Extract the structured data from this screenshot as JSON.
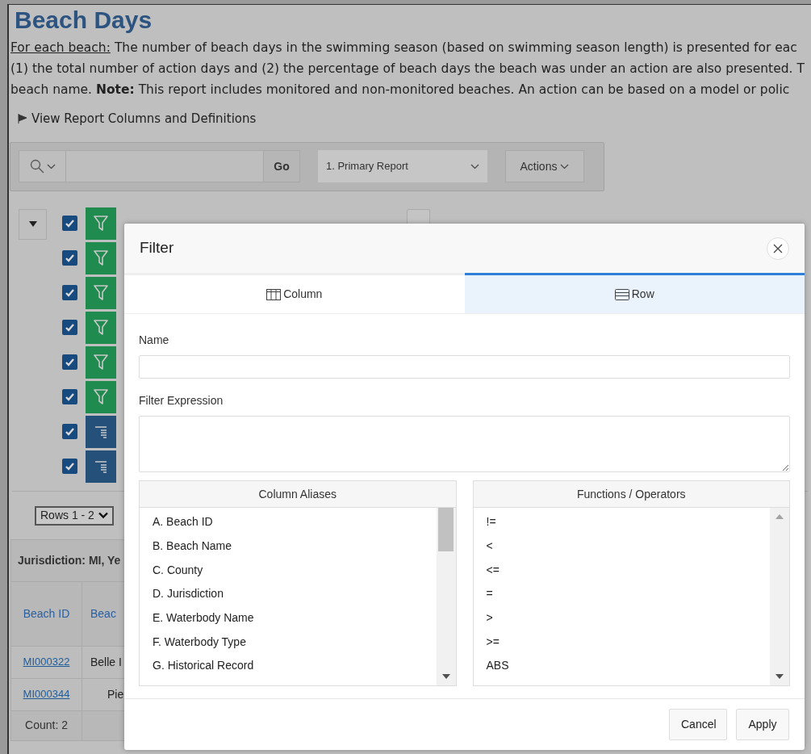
{
  "page_title": "Beach Days",
  "description": {
    "lead": "For each beach:",
    "lines": [
      "The number of beach days in the swimming season (based on swimming season length) is presented for eac",
      "(1) the total number of action days and (2) the percentage of beach days the beach was under an action are also presented. T",
      "beach name. **Note:** This report includes monitored and non-monitored beaches. An action can be based on a model or polic"
    ]
  },
  "definitions_link": "View Report Columns and Definitions",
  "toolbar": {
    "go_button": "Go",
    "report_select": "1. Primary Report",
    "actions_button": "Actions"
  },
  "report_settings": [
    {
      "kind": "filter",
      "checked": true
    },
    {
      "kind": "filter",
      "checked": true
    },
    {
      "kind": "filter",
      "checked": true
    },
    {
      "kind": "filter",
      "checked": true
    },
    {
      "kind": "filter",
      "checked": true
    },
    {
      "kind": "filter",
      "checked": true
    },
    {
      "kind": "lines",
      "checked": true
    },
    {
      "kind": "lines",
      "checked": true
    }
  ],
  "pagination_select": "Rows 1 - 2",
  "table": {
    "group_header": "Jurisdiction: MI, Ye",
    "columns": [
      "Beach ID",
      "Beac"
    ],
    "rows": [
      [
        "MI000322",
        "Belle I"
      ],
      [
        "MI000344",
        "Pie"
      ]
    ],
    "footer": "Count: 2"
  },
  "dialog": {
    "title": "Filter",
    "tabs": [
      {
        "label": "Column",
        "kind": "column",
        "selected": false
      },
      {
        "label": "Row",
        "kind": "row",
        "selected": true
      }
    ],
    "name_label": "Name",
    "expression_label": "Filter Expression",
    "lists": [
      {
        "title": "Column Aliases",
        "items": [
          "A. Beach ID",
          "B. Beach Name",
          "C. County",
          "D. Jurisdiction",
          "E. Waterbody Name",
          "F. Waterbody Type",
          "G. Historical Record"
        ]
      },
      {
        "title": "Functions / Operators",
        "items": [
          "!=",
          "<",
          "<=",
          "=",
          ">",
          ">=",
          "ABS"
        ]
      }
    ],
    "buttons": [
      "Cancel",
      "Apply"
    ]
  }
}
